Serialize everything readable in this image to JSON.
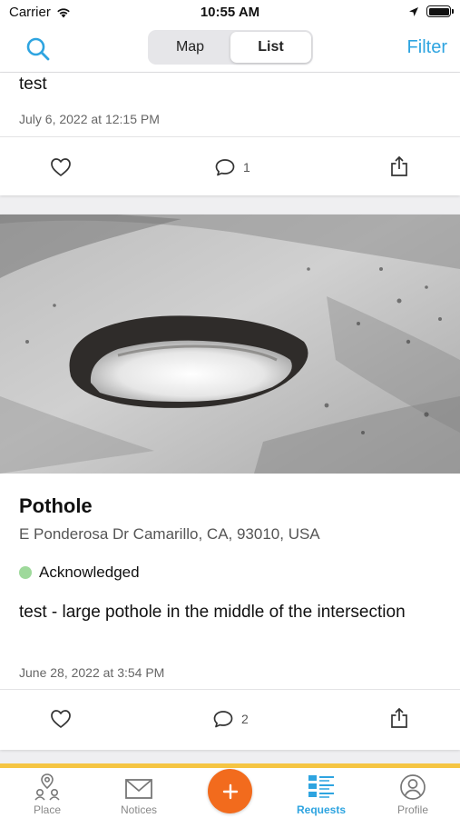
{
  "status_bar": {
    "carrier": "Carrier",
    "time": "10:55 AM"
  },
  "nav": {
    "segments": [
      {
        "label": "Map",
        "active": false
      },
      {
        "label": "List",
        "active": true
      }
    ],
    "filter_label": "Filter"
  },
  "requests": [
    {
      "description": "test",
      "date": "July 6, 2022 at 12:15 PM",
      "comment_count": "1"
    },
    {
      "title": "Pothole",
      "address": "E Ponderosa Dr Camarillo, CA, 93010, USA",
      "status": "Acknowledged",
      "status_color": "#9ed99b",
      "description": "test - large pothole in the middle of the intersection",
      "date": "June 28, 2022 at 3:54 PM",
      "comment_count": "2"
    }
  ],
  "tab_bar": {
    "tabs": [
      {
        "label": "Place",
        "icon": "place-icon",
        "active": false
      },
      {
        "label": "Notices",
        "icon": "envelope-icon",
        "active": false
      },
      {
        "label": "Requests",
        "icon": "requests-list-icon",
        "active": true
      },
      {
        "label": "Profile",
        "icon": "profile-icon",
        "active": false
      }
    ],
    "add_icon": "plus-icon"
  },
  "colors": {
    "accent": "#2ea4e0",
    "fab": "#f26b1d",
    "tab_border": "#f5c542"
  }
}
